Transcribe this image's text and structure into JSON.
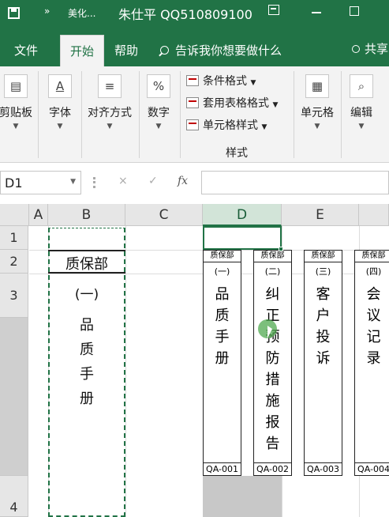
{
  "title_bar": {
    "qa_more": "»",
    "file_short": "美化...",
    "title": "朱仕平 QQ510809100",
    "ribbon_options_icon": "ribbon-display-options-icon",
    "minimize_icon": "minimize-icon",
    "maximize_icon": "maximize-icon"
  },
  "tabs": {
    "file": "文件",
    "home": "开始",
    "help": "帮助",
    "tell_me": "告诉我你想要做什么",
    "share": "共享"
  },
  "ribbon": {
    "clipboard": "剪贴板",
    "font": "字体",
    "font_icon_glyph": "A",
    "alignment": "对齐方式",
    "number": "数字",
    "number_icon_glyph": "%",
    "conditional_formatting": "条件格式",
    "format_as_table": "套用表格格式",
    "cell_styles": "单元格样式",
    "styles_group": "样式",
    "cells": "单元格",
    "editing": "编辑"
  },
  "formula_bar": {
    "name_box": "D1",
    "cancel": "×",
    "enter": "✓",
    "fx": "fx",
    "formula": ""
  },
  "columns": [
    "A",
    "B",
    "C",
    "D",
    "E"
  ],
  "rows": [
    "1",
    "2",
    "3",
    "4"
  ],
  "cell_b": {
    "dept": "质保部",
    "number": "(一)",
    "text": "品质手册"
  },
  "cards": [
    {
      "dept": "质保部",
      "number": "(一)",
      "text": "品质手册",
      "code": "QA-001"
    },
    {
      "dept": "质保部",
      "number": "(二)",
      "text": "纠正预防措施报告",
      "code": "QA-002"
    },
    {
      "dept": "质保部",
      "number": "(三)",
      "text": "客户投诉",
      "code": "QA-003"
    },
    {
      "dept": "质保部",
      "number": "(四)",
      "text": "会议记录",
      "code": "QA-004"
    }
  ],
  "colors": {
    "accent": "#217346",
    "selection_fill": "#d2e4d8"
  }
}
